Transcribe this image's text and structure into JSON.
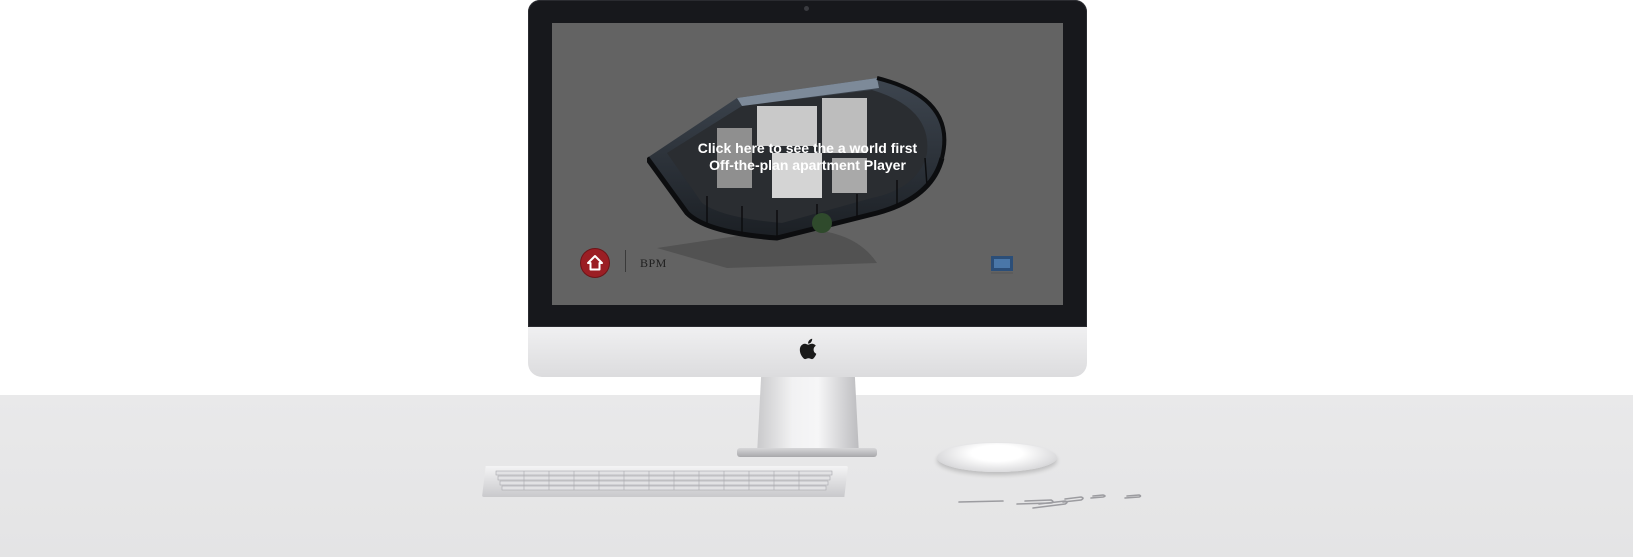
{
  "player": {
    "cta_line1": "Click here to see the a world first",
    "cta_line2": "Off-the-plan apartment Player",
    "brand_name": "BPM",
    "home_icon": "house-icon",
    "badge_icon": "player-badge-icon"
  },
  "colors": {
    "screen_bg": "#636363",
    "home_button": "#9b1e24",
    "bezel": "#17181c",
    "desk": "#e8e8e9"
  },
  "device": {
    "logo_icon": "apple-icon"
  }
}
